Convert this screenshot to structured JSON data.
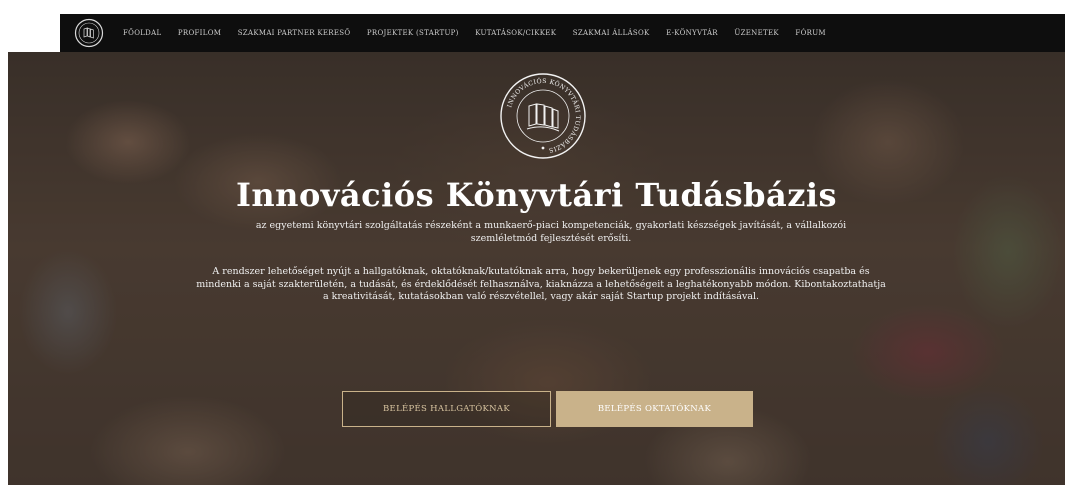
{
  "nav": {
    "logo_icon": "library-seal-icon",
    "items": [
      {
        "label": "FŐOLDAL"
      },
      {
        "label": "PROFILOM"
      },
      {
        "label": "SZAKMAI PARTNER KERESŐ"
      },
      {
        "label": "PROJEKTEK (STARTUP)"
      },
      {
        "label": "KUTATÁSOK/CIKKEK"
      },
      {
        "label": "SZAKMAI ÁLLÁSOK"
      },
      {
        "label": "E-KÖNYVTÁR"
      },
      {
        "label": "ÜZENETEK"
      },
      {
        "label": "FÓRUM"
      }
    ]
  },
  "hero": {
    "emblem_icon": "library-seal-icon",
    "emblem_text": "INNOVÁCIÓS KÖNYVTÁRI TUDÁSBÁZIS",
    "title": "Innovációs Könyvtári Tudásbázis",
    "subtitle": "az egyetemi könyvtári szolgáltatás részeként a munkaerő-piaci kompetenciák, gyakorlati készségek javítását, a vállalkozói szemléletmód fejlesztését erősíti.",
    "description": "A rendszer lehetőséget nyújt a hallgatóknak, oktatóknak/kutatóknak arra, hogy bekerüljenek egy professzionális innovációs csapatba és mindenki a saját szakterületén, a tudását, és érdeklődését felhasználva, kiaknázza a lehetőségeit a leghatékonyabb módon. Kibontakoztathatja a kreativitását, kutatásokban való részvétellel, vagy akár saját Startup projekt indításával.",
    "buttons": {
      "students": "BELÉPÉS HALLGATÓKNAK",
      "teachers": "BELÉPÉS OKTATÓKNAK"
    }
  },
  "colors": {
    "nav_bg": "#0e0e0e",
    "accent_gold": "#c9b28a",
    "text_light": "#ffffff"
  }
}
